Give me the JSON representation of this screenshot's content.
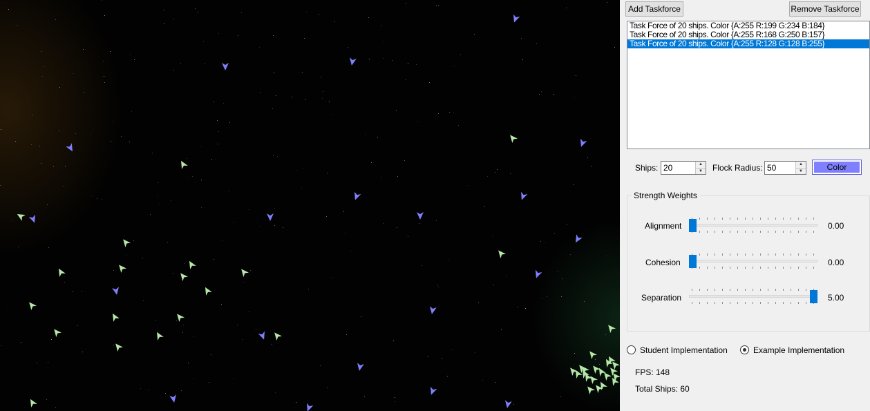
{
  "buttons": {
    "add_taskforce": "Add Taskforce",
    "remove_taskforce": "Remove Taskforce",
    "color": "Color"
  },
  "taskforces": [
    {
      "label": "Task Force of 20 ships. Color {A:255 R:199 G:234 B:184}",
      "selected": false
    },
    {
      "label": "Task Force of 20 ships. Color {A:255 R:168 G:250 B:157}",
      "selected": false
    },
    {
      "label": "Task Force of 20 ships. Color {A:255 R:128 G:128 B:255}",
      "selected": true
    }
  ],
  "settings": {
    "ships_label": "Ships:",
    "ships_value": "20",
    "flock_radius_label": "Flock Radius:",
    "flock_radius_value": "50",
    "color_value": "#8080ff"
  },
  "weights": {
    "title": "Strength Weights",
    "alignment": {
      "label": "Alignment",
      "value": "0.00",
      "fraction": 0.0
    },
    "cohesion": {
      "label": "Cohesion",
      "value": "0.00",
      "fraction": 0.0
    },
    "separation": {
      "label": "Separation",
      "value": "5.00",
      "fraction": 1.0
    }
  },
  "implementation": {
    "student_label": "Student Implementation",
    "example_label": "Example Implementation",
    "selected": "example"
  },
  "stats": {
    "fps": "FPS: 148",
    "total_ships": "Total Ships: 60"
  },
  "colors": {
    "ship_green": "#b6e8a8",
    "ship_blue": "#8080ff",
    "selection": "#0078d7"
  }
}
